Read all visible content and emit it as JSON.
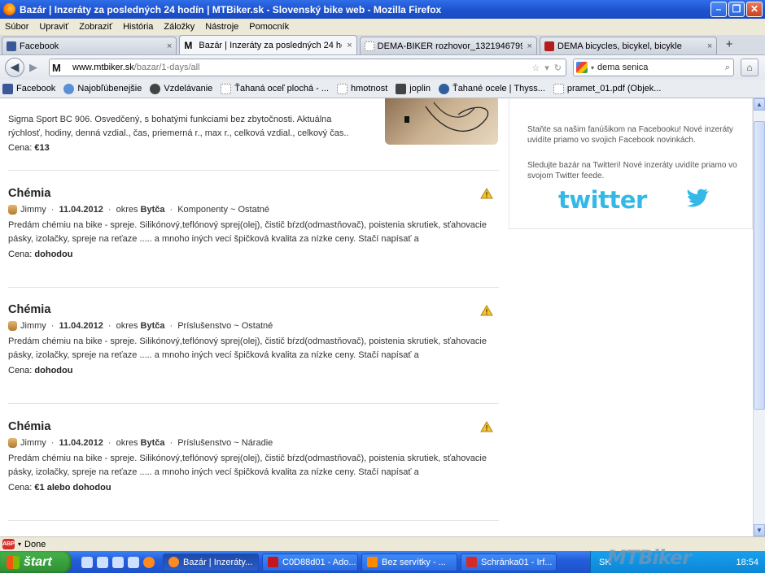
{
  "window": {
    "title": "Bazár | Inzeráty za posledných 24 hodín | MTBiker.sk - Slovenský bike web - Mozilla Firefox"
  },
  "menu": [
    "Súbor",
    "Upraviť",
    "Zobraziť",
    "História",
    "Záložky",
    "Nástroje",
    "Pomocník"
  ],
  "tabs": [
    {
      "label": "Facebook",
      "icon": "facebook-icon"
    },
    {
      "label": "Bazár | Inzeráty za posledných 24 hodí...",
      "icon": "mtbiker-icon"
    },
    {
      "label": "DEMA-BIKER rozhovor_1321946799.pd...",
      "icon": "document-icon"
    },
    {
      "label": "DEMA bicycles, bicykel, bicykle",
      "icon": "dema-icon"
    }
  ],
  "nav": {
    "url_host": "www.mtbiker.sk",
    "url_path": "/bazar/1-days/all",
    "search_value": "dema senica"
  },
  "bookmarks": [
    "Facebook",
    "Najobľúbenejšie",
    "Vzdelávanie",
    "Ťahaná oceľ plochá - ...",
    "hmotnost",
    "joplin",
    "Ťahané ocele | Thyss...",
    "pramet_01.pdf (Objek..."
  ],
  "first_ad": {
    "desc": "Sigma Sport BC 906. Osvedčený, s bohatými funkciami bez zbytočnosti. Aktuálna rýchlosť, hodiny, denná vzdial., čas, priemerná r., max r., celková vzdial., celkový čas..",
    "price_label": "Cena:",
    "price": "€13"
  },
  "ads": [
    {
      "title": "Chémia",
      "user": "Jimmy",
      "date": "11.04.2012",
      "district_label": "okres",
      "district": "Bytča",
      "category": "Komponenty ~ Ostatné",
      "desc": "Predám chémiu na bike - spreje. Silikónový,teflónový sprej(olej), čistič bŕzd(odmastňovač), poistenia skrutiek, sťahovacie pásky, izolačky, spreje na reťaze ..... a mnoho iných vecí špičková kvalita za nízke ceny. Stačí napísať a",
      "price_label": "Cena:",
      "price": "dohodou",
      "price_prefix": ""
    },
    {
      "title": "Chémia",
      "user": "Jimmy",
      "date": "11.04.2012",
      "district_label": "okres",
      "district": "Bytča",
      "category": "Príslušenstvo ~ Ostatné",
      "desc": "Predám chémiu na bike - spreje. Silikónový,teflónový sprej(olej), čistič bŕzd(odmastňovač), poistenia skrutiek, sťahovacie pásky, izolačky, spreje na reťaze ..... a mnoho iných vecí špičková kvalita za nízke ceny. Stačí napísať a",
      "price_label": "Cena:",
      "price": "dohodou",
      "price_prefix": ""
    },
    {
      "title": "Chémia",
      "user": "Jimmy",
      "date": "11.04.2012",
      "district_label": "okres",
      "district": "Bytča",
      "category": "Príslušenstvo ~ Náradie",
      "desc": "Predám chémiu na bike - spreje. Silikónový,teflónový sprej(olej), čistič bŕzd(odmastňovač), poistenia skrutiek, sťahovacie pásky, izolačky, spreje na reťaze ..... a mnoho iných vecí špičková kvalita za nízke ceny. Stačí napísať a",
      "price_label": "Cena:",
      "price": "dohodou",
      "price_prefix": "€1 alebo"
    }
  ],
  "sidebar": {
    "facebook_text": "Staňte sa našim fanúšikom na Facebooku! Nové inzeráty uvidíte priamo vo svojich Facebook novinkách.",
    "twitter_text": "Sledujte bazár na Twitteri! Nové inzeráty uvidíte priamo vo svojom Twitter feede.",
    "twitter_logo": "twitter"
  },
  "status": {
    "text": "Done",
    "abp": "ABP"
  },
  "taskbar": {
    "start": "štart",
    "items": [
      {
        "label": "Bazár | Inzeráty...",
        "icon": "firefox-icon"
      },
      {
        "label": "C0D88d01 - Ado...",
        "icon": "pdf-icon"
      },
      {
        "label": "Bez servítky - ...",
        "icon": "vlc-icon"
      },
      {
        "label": "Schránka01 - Irf...",
        "icon": "irfanview-icon"
      }
    ],
    "lang": "SK",
    "clock": "18:54",
    "watermark": "MTBiker"
  },
  "colors": {
    "title_bar": "#1d52cf",
    "twitter_blue": "#33b8e8",
    "warning": "#e8b320"
  }
}
